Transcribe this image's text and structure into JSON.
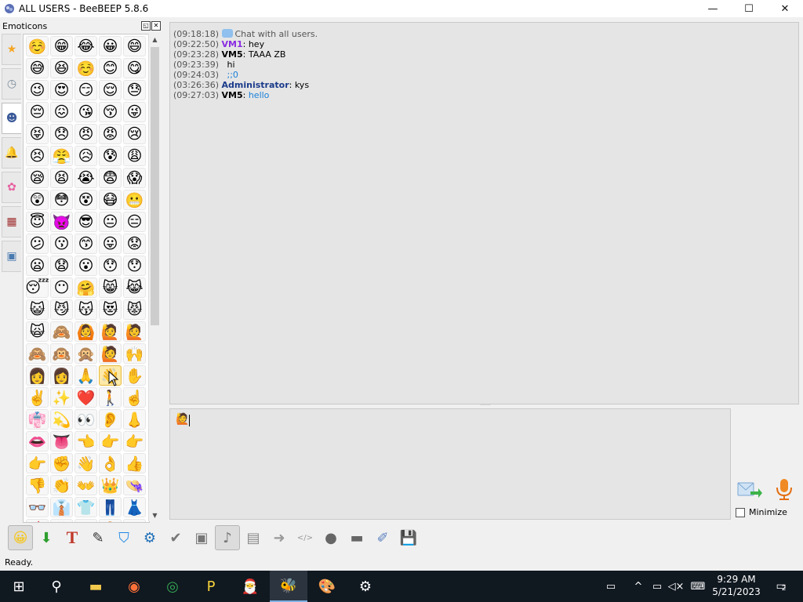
{
  "window": {
    "title": "ALL USERS - BeeBEEP 5.8.6",
    "controls": {
      "minimize": "—",
      "maximize": "☐",
      "close": "✕"
    }
  },
  "emoticons_panel": {
    "title": "Emoticons",
    "header_buttons": [
      "◱",
      "✕"
    ],
    "categories": [
      {
        "icon": "star-icon",
        "glyph": "★",
        "color": "#f5a623"
      },
      {
        "icon": "clock-icon",
        "glyph": "◷",
        "color": "#7a8a9a"
      },
      {
        "icon": "people-icon",
        "glyph": "☻",
        "color": "#3b5a99",
        "active": true
      },
      {
        "icon": "bell-icon",
        "glyph": "🔔",
        "color": "#c08a2d"
      },
      {
        "icon": "flower-icon",
        "glyph": "✿",
        "color": "#e85fa0"
      },
      {
        "icon": "building-icon",
        "glyph": "▦",
        "color": "#a03030"
      },
      {
        "icon": "symbols-icon",
        "glyph": "▣",
        "color": "#4a7ab0"
      }
    ],
    "emojis": [
      "☺️",
      "😁",
      "😂",
      "😀",
      "😄",
      "😅",
      "😆",
      "☺️",
      "😊",
      "😋",
      "😉",
      "😍",
      "😏",
      "😌",
      "😓",
      "😔",
      "😖",
      "😘",
      "😚",
      "😜",
      "😝",
      "😞",
      "😠",
      "😡",
      "😢",
      "😣",
      "😤",
      "😥",
      "😰",
      "😩",
      "😪",
      "😫",
      "😭",
      "😨",
      "😱",
      "😲",
      "😳",
      "😵",
      "😷",
      "😬",
      "😇",
      "👿",
      "😎",
      "😐",
      "😑",
      "😕",
      "😗",
      "😙",
      "😛",
      "😟",
      "😦",
      "😧",
      "😮",
      "😯",
      "😯",
      "😴",
      "😶",
      "🤗",
      "😸",
      "😹",
      "😺",
      "😼",
      "😽",
      "😻",
      "😾",
      "🙀",
      "🙈",
      "🙆",
      "🙋",
      "🙋",
      "🙈",
      "🙉",
      "🙊",
      "🙋",
      "🙌",
      "👩",
      "👩",
      "🙏",
      "👋",
      "✋",
      "✌️",
      "✨",
      "❤️",
      "🚶",
      "☝️",
      "👘",
      "💫",
      "👀",
      "👂",
      "👃",
      "👄",
      "👅",
      "👈",
      "👉",
      "👉",
      "👉",
      "✊",
      "👋",
      "👌",
      "👍",
      "👎",
      "👏",
      "👐",
      "👑",
      "👒",
      "👓",
      "👔",
      "👕",
      "👖",
      "👗",
      "👙",
      "👚",
      "👛",
      "👜",
      "👝"
    ],
    "selected_index": 78
  },
  "chat": {
    "messages": [
      {
        "ts": "(09:18:18)",
        "user": "",
        "text": "Chat with all users.",
        "kind": "system"
      },
      {
        "ts": "(09:22:50)",
        "user": "VM1",
        "text": "hey",
        "kind": "vm1"
      },
      {
        "ts": "(09:23:28)",
        "user": "VM5",
        "text": "TAAA ZB",
        "kind": "vm5"
      },
      {
        "ts": "(09:23:39)",
        "user": "",
        "text": "  hi",
        "kind": "cont"
      },
      {
        "ts": "(09:24:03)",
        "user": "",
        "text": "  ;;0",
        "kind": "cont-blue"
      },
      {
        "ts": "(03:26:36)",
        "user": "Administrator",
        "text": "kys",
        "kind": "admin"
      },
      {
        "ts": "(09:27:03)",
        "user": "VM5",
        "text": "hello",
        "kind": "vm5-blue"
      }
    ]
  },
  "input": {
    "value_emoji": "🙋",
    "minimize_label": "Minimize"
  },
  "toolbar": {
    "buttons": [
      {
        "name": "emoticons-button",
        "glyph": "😀",
        "pressed": true
      },
      {
        "name": "down-arrow-button",
        "glyph": "⬇"
      },
      {
        "name": "font-button",
        "glyph": "T"
      },
      {
        "name": "color-button",
        "glyph": "✎"
      },
      {
        "name": "filter-button",
        "glyph": "⛉"
      },
      {
        "name": "settings-button",
        "glyph": "⚙"
      },
      {
        "name": "spell-check-button",
        "glyph": "✔"
      },
      {
        "name": "image-button",
        "glyph": "▣"
      },
      {
        "name": "music-button",
        "glyph": "♪",
        "pressed": true
      },
      {
        "name": "document-button",
        "glyph": "▤"
      },
      {
        "name": "forward-button",
        "glyph": "➜"
      },
      {
        "name": "html-button",
        "glyph": "</>"
      },
      {
        "name": "record-button",
        "glyph": "●"
      },
      {
        "name": "screenshot-button",
        "glyph": "▬"
      },
      {
        "name": "edit-button",
        "glyph": "✐"
      },
      {
        "name": "save-button",
        "glyph": "💾"
      }
    ]
  },
  "status": {
    "text": "Ready."
  },
  "taskbar": {
    "time": "9:29 AM",
    "date": "5/21/2023",
    "notifications": "2",
    "items": [
      {
        "name": "start-icon",
        "glyph": "⊞"
      },
      {
        "name": "search-icon",
        "glyph": "⚲"
      },
      {
        "name": "file-explorer-icon",
        "glyph": "▬"
      },
      {
        "name": "firefox-icon",
        "glyph": "◉"
      },
      {
        "name": "chrome-icon",
        "glyph": "◎"
      },
      {
        "name": "app-p-icon",
        "glyph": "P"
      },
      {
        "name": "santa-icon",
        "glyph": "🎅"
      },
      {
        "name": "beebeep-icon",
        "glyph": "🐝"
      },
      {
        "name": "paint-icon",
        "glyph": "🎨"
      },
      {
        "name": "settings-icon",
        "glyph": "⚙"
      }
    ]
  },
  "colors": {
    "chat_bg": "#e5e5e5",
    "vm1": "#8a2be2",
    "admin": "#1a3a8a",
    "link_blue": "#1a7fd8"
  }
}
